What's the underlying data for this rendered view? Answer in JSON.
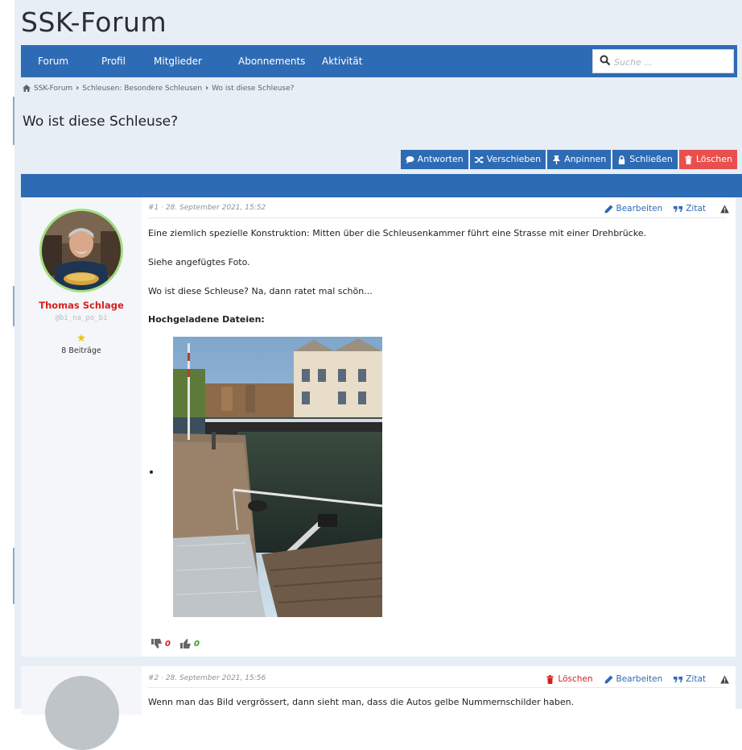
{
  "site": {
    "title": "SSK-Forum"
  },
  "nav": {
    "items": [
      {
        "label": "Forum"
      },
      {
        "label": "Profil"
      },
      {
        "label": "Mitglieder"
      },
      {
        "label": "Abonnements"
      },
      {
        "label": "Aktivität"
      }
    ],
    "search_placeholder": "Suche ..."
  },
  "breadcrumb": {
    "items": [
      "SSK-Forum",
      "Schleusen: Besondere Schleusen",
      "Wo ist diese Schleuse?"
    ]
  },
  "topic": {
    "title": "Wo ist diese Schleuse?"
  },
  "topic_actions": [
    {
      "label": "Antworten",
      "icon": "comment-icon"
    },
    {
      "label": "Verschieben",
      "icon": "shuffle-icon"
    },
    {
      "label": "Anpinnen",
      "icon": "pin-icon"
    },
    {
      "label": "Schließen",
      "icon": "lock-icon"
    },
    {
      "label": "Löschen",
      "icon": "trash-icon",
      "color": "#e8504f"
    }
  ],
  "posts": [
    {
      "meta": "#1 · 28. September 2021, 15:52",
      "author": {
        "name": "Thomas Schlage",
        "handle": "@bi_na_po_bi",
        "post_count": "8 Beiträge",
        "name_color": "#d9201f"
      },
      "tools": {
        "edit": "Bearbeiten",
        "quote": "Zitat"
      },
      "paragraphs": [
        "Eine ziemlich spezielle Konstruktion: Mitten über die Schleusenkammer führt eine Strasse mit einer Drehbrücke.",
        "Siehe angefügtes Foto.",
        "Wo ist diese Schleuse? Na, dann ratet mal schön..."
      ],
      "attachments_heading": "Hochgeladene Dateien:",
      "votes": {
        "down": "0",
        "up": "0"
      }
    },
    {
      "meta": "#2 · 28. September 2021, 15:56",
      "tools": {
        "delete": "Löschen",
        "edit": "Bearbeiten",
        "quote": "Zitat"
      },
      "paragraphs": [
        "Wenn man das Bild vergrössert, dann sieht man, dass die Autos gelbe Nummernschilder haben."
      ]
    }
  ],
  "colors": {
    "primary": "#2e6bb5",
    "danger": "#e8504f",
    "author": "#d9201f",
    "upvote": "#3b9a1c"
  }
}
